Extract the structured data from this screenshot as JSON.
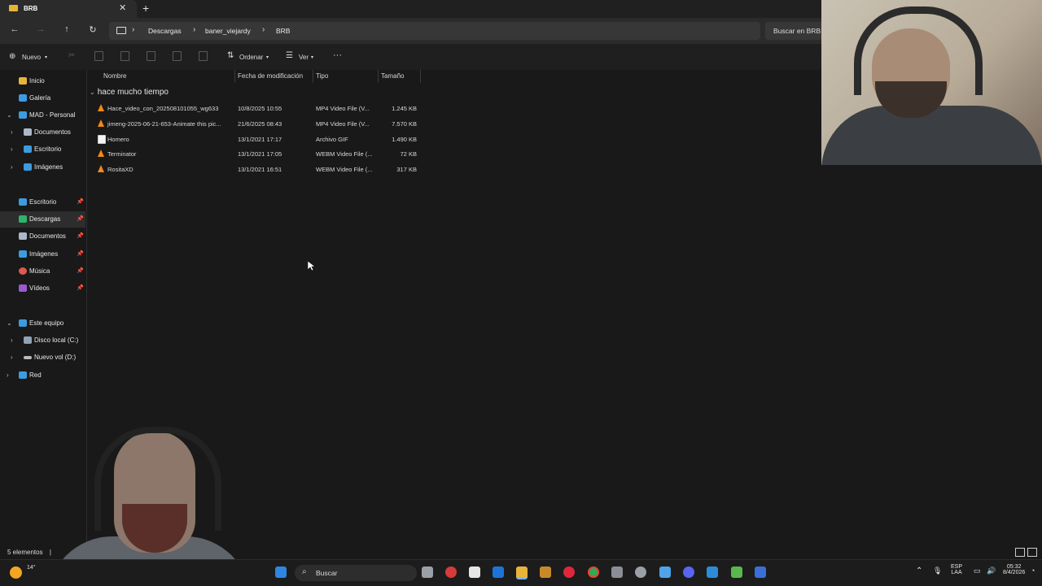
{
  "window": {
    "tab_title": "BRB",
    "new_tab_label": "+",
    "close_tab_label": "✕"
  },
  "nav": {
    "breadcrumb": [
      "Descargas",
      "baner_viejardy",
      "BRB"
    ],
    "search_placeholder": "Buscar en BRB"
  },
  "commands": {
    "new_label": "Nuevo",
    "sort_label": "Ordenar",
    "view_label": "Ver",
    "more_label": "···"
  },
  "sidebar": {
    "top": [
      {
        "label": "Inicio",
        "icon": "home-icon",
        "color": "#e8b339"
      },
      {
        "label": "Galería",
        "icon": "gallery-icon",
        "color": "#3d9be0"
      },
      {
        "label": "MAD - Personal",
        "icon": "cloud-icon",
        "color": "#3d9be0"
      }
    ],
    "onedrive_children": [
      {
        "label": "Documentos",
        "icon": "document-icon",
        "color": "#aab8c8"
      },
      {
        "label": "Escritorio",
        "icon": "desktop-icon",
        "color": "#3d9be0"
      },
      {
        "label": "Imágenes",
        "icon": "pictures-icon",
        "color": "#3d9be0"
      }
    ],
    "pinned": [
      {
        "label": "Escritorio",
        "icon": "desktop-icon",
        "color": "#3d9be0"
      },
      {
        "label": "Descargas",
        "icon": "download-icon",
        "color": "#2fb36b"
      },
      {
        "label": "Documentos",
        "icon": "document-icon",
        "color": "#aab8c8"
      },
      {
        "label": "Imágenes",
        "icon": "pictures-icon",
        "color": "#3d9be0"
      },
      {
        "label": "Música",
        "icon": "music-icon",
        "color": "#e0584f"
      },
      {
        "label": "Vídeos",
        "icon": "video-icon",
        "color": "#9b59d0"
      }
    ],
    "this_pc": {
      "label": "Este equipo",
      "icon": "pc-icon",
      "color": "#3d9be0"
    },
    "drives": [
      {
        "label": "Disco local (C:)",
        "icon": "drive-icon",
        "color": "#8fa3b8"
      },
      {
        "label": "Nuevo vol (D:)",
        "icon": "drive-icon",
        "color": "#bbbbbb"
      }
    ],
    "network": {
      "label": "Red",
      "icon": "network-icon",
      "color": "#3d9be0"
    },
    "pin_glyph": "📌"
  },
  "columns": {
    "name": "Nombre",
    "modified": "Fecha de modificación",
    "type": "Tipo",
    "size": "Tamaño"
  },
  "group_label": "hace mucho tiempo",
  "files": [
    {
      "name": "Hace_video_con_202508101055_wg633",
      "modified": "10/8/2025 10:55",
      "type": "MP4 Video File (V...",
      "size": "1.245 KB",
      "icon": "vlc-icon"
    },
    {
      "name": "jimeng-2025-06-21-653-Animate this pic...",
      "modified": "21/6/2025 08:43",
      "type": "MP4 Video File (V...",
      "size": "7.570 KB",
      "icon": "vlc-icon"
    },
    {
      "name": "Homero",
      "modified": "13/1/2021 17:17",
      "type": "Archivo GIF",
      "size": "1.490 KB",
      "icon": "gif-file-icon"
    },
    {
      "name": "Terminator",
      "modified": "13/1/2021 17:05",
      "type": "WEBM Video File (...",
      "size": "72 KB",
      "icon": "vlc-icon"
    },
    {
      "name": "RositaXD",
      "modified": "13/1/2021 16:51",
      "type": "WEBM Video File (...",
      "size": "317 KB",
      "icon": "vlc-icon"
    }
  ],
  "status": {
    "count": "5 elementos",
    "sep": "|"
  },
  "taskbar": {
    "search_label": "Buscar",
    "weather_temp": "14°",
    "lang_top": "ESP",
    "lang_bottom": "LAA",
    "time": "05:32",
    "date": "8/4/2026"
  }
}
